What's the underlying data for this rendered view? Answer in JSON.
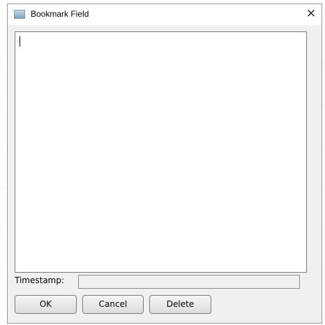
{
  "window": {
    "title": "Bookmark Field",
    "close_glyph": "✕",
    "icon": "app-window-icon"
  },
  "editor": {
    "text": ""
  },
  "timestamp": {
    "label": "Timestamp:",
    "value": ""
  },
  "buttons": {
    "ok": "OK",
    "cancel": "Cancel",
    "delete": "Delete"
  }
}
